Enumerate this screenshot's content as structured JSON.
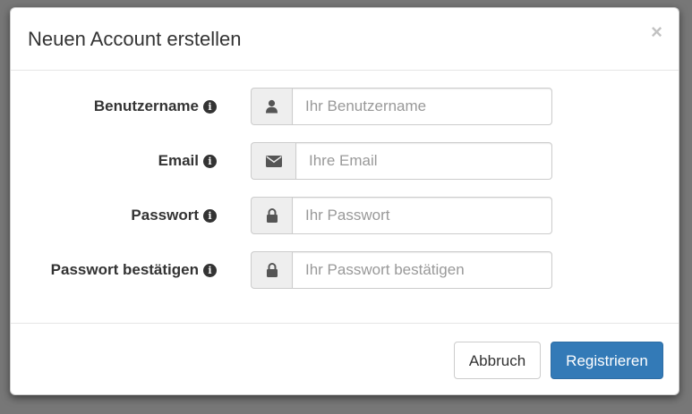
{
  "modal": {
    "title": "Neuen Account erstellen",
    "close_glyph": "×"
  },
  "form": {
    "fields": [
      {
        "label": "Benutzername",
        "icon": "user-icon",
        "placeholder": "Ihr Benutzername",
        "value": ""
      },
      {
        "label": "Email",
        "icon": "envelope-icon",
        "placeholder": "Ihre Email",
        "value": ""
      },
      {
        "label": "Passwort",
        "icon": "lock-icon",
        "placeholder": "Ihr Passwort",
        "value": ""
      },
      {
        "label": "Passwort bestätigen",
        "icon": "lock-icon",
        "placeholder": "Ihr Passwort bestätigen",
        "value": ""
      }
    ],
    "info_glyph": "i"
  },
  "footer": {
    "cancel_label": "Abbruch",
    "submit_label": "Registrieren"
  },
  "colors": {
    "primary": "#337ab7",
    "backdrop": "#777777",
    "addon_bg": "#eeeeee"
  }
}
